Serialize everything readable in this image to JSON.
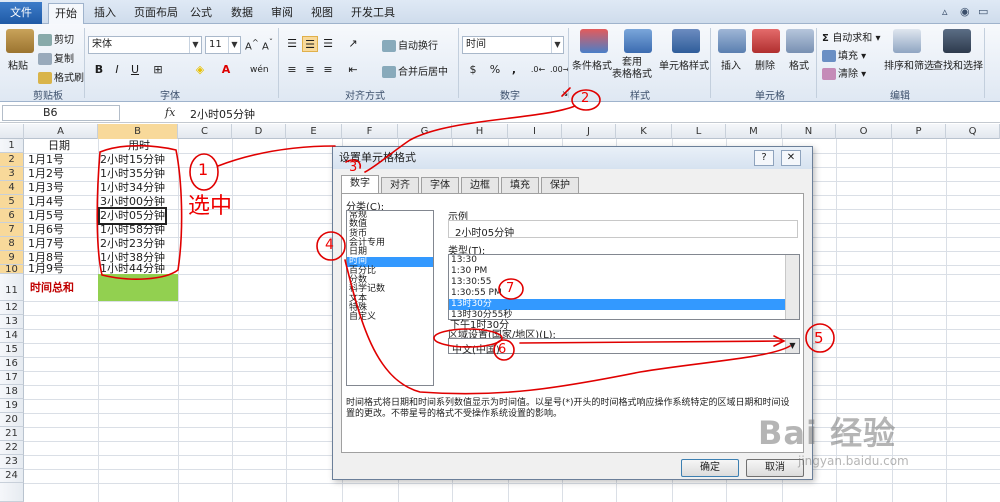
{
  "ribbon_tabs": {
    "file": "文件",
    "items": [
      "开始",
      "插入",
      "页面布局",
      "公式",
      "数据",
      "审阅",
      "视图",
      "开发工具"
    ]
  },
  "clipboard": {
    "paste": "粘贴",
    "cut": "剪切",
    "copy": "复制",
    "format_painter": "格式刷",
    "group": "剪贴板"
  },
  "font": {
    "name": "宋体",
    "size": "11",
    "bold": "B",
    "italic": "I",
    "underline": "U",
    "group": "字体"
  },
  "alignment": {
    "wrap": "自动换行",
    "merge": "合并后居中",
    "group": "对齐方式"
  },
  "number": {
    "format": "时间",
    "currency": "$",
    "percent": "%",
    "comma": ",",
    "group": "数字"
  },
  "styles": {
    "conditional": "条件格式",
    "table": "套用\n表格格式",
    "cell_style": "单元格样式",
    "group": "样式"
  },
  "cells": {
    "insert": "插入",
    "delete": "删除",
    "format": "格式",
    "group": "单元格"
  },
  "editing": {
    "autosum": "自动求和",
    "fill": "填充",
    "clear": "清除",
    "sort": "排序和筛选",
    "find": "查找和选择",
    "group": "编辑"
  },
  "formula_bar": {
    "name_box": "B6",
    "fx": "fx",
    "content": "2小时05分钟"
  },
  "columns": [
    "A",
    "B",
    "C",
    "D",
    "E",
    "F",
    "G",
    "H",
    "I",
    "J",
    "K",
    "L",
    "M",
    "N",
    "O",
    "P",
    "Q"
  ],
  "rows": [
    "1",
    "2",
    "3",
    "4",
    "5",
    "6",
    "7",
    "8",
    "9",
    "10",
    "11",
    "12",
    "13",
    "14",
    "15",
    "16",
    "17",
    "18",
    "19",
    "20",
    "21",
    "22",
    "23",
    "24"
  ],
  "sheet": {
    "header_date": "日期",
    "header_time": "用时",
    "dates": [
      "1月1号",
      "1月2号",
      "1月3号",
      "1月4号",
      "1月5号",
      "1月6号",
      "1月7号",
      "1月8号",
      "1月9号"
    ],
    "times": [
      "2小时15分钟",
      "1小时35分钟",
      "1小时34分钟",
      "3小时00分钟",
      "2小时05分钟",
      "1小时58分钟",
      "2小时23分钟",
      "1小时38分钟",
      "1小时44分钟"
    ],
    "total_label": "时间总和",
    "total_color": "#92d050"
  },
  "dialog": {
    "title": "设置单元格格式",
    "help": "?",
    "close": "✕",
    "tabs": [
      "数字",
      "对齐",
      "字体",
      "边框",
      "填充",
      "保护"
    ],
    "category_label": "分类(C):",
    "categories": [
      "常规",
      "数值",
      "货币",
      "会计专用",
      "日期",
      "时间",
      "百分比",
      "分数",
      "科学记数",
      "文本",
      "特殊",
      "自定义"
    ],
    "selected_category": "时间",
    "sample_label": "示例",
    "sample_value": "2小时05分钟",
    "type_label": "类型(T):",
    "types": [
      "13:30",
      "1:30 PM",
      "13:30:55",
      "1:30:55 PM",
      "13时30分",
      "13时30分55秒",
      "下午1时30分"
    ],
    "locale_label": "区域设置(国家/地区)(L):",
    "locale_value": "中文(中国)",
    "description": "时间格式将日期和时间系列数值显示为时间值。以星号(*)开头的时间格式响应操作系统特定的区域日期和时间设置的更改。不带星号的格式不受操作系统设置的影响。",
    "ok": "确定",
    "cancel": "取消"
  },
  "annotations": {
    "n1": "1",
    "xuanzhong": "选中",
    "n2": "2",
    "n3": "3",
    "n4": "4",
    "n5": "5",
    "n6": "6",
    "n7": "7"
  },
  "watermark": {
    "brand": "Bai 经验",
    "url": "jingyan.baidu.com"
  },
  "colors": {
    "annotation_red": "#e00000",
    "selection_blue": "#3399ff",
    "total_label_red": "#c00000"
  }
}
